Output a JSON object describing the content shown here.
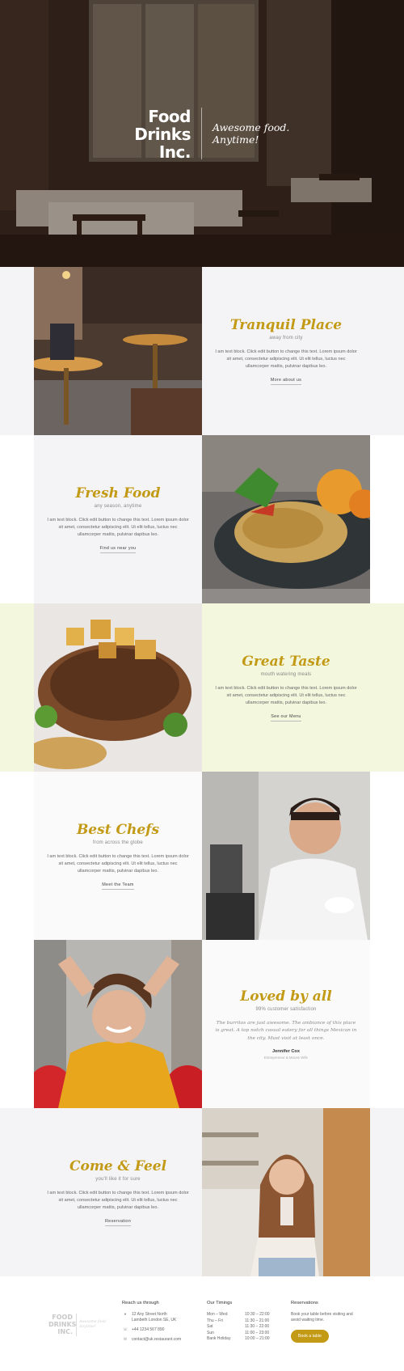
{
  "hero": {
    "brand": [
      "Food",
      "Drinks",
      "Inc."
    ],
    "tagline": [
      "Awesome food.",
      "Anytime!"
    ]
  },
  "sections": [
    {
      "title": "Tranquil Place",
      "subtitle": "away from city",
      "text": "I am text block. Click edit button to change this text. Lorem ipsum dolor sit amet, consectetur adipiscing elit. Ut elit tellus, luctus nec ullamcorper mattis, pulvinar dapibus leo.",
      "link": "More about us",
      "image": "restaurant-interior"
    },
    {
      "title": "Fresh Food",
      "subtitle": "any season, anytime",
      "text": "I am text block. Click edit button to change this text. Lorem ipsum dolor sit amet, consectetur adipiscing elit. Ut elit tellus, luctus nec ullamcorper mattis, pulvinar dapibus leo.",
      "link": "Find us near you",
      "image": "pasta-dish"
    },
    {
      "title": "Great Taste",
      "subtitle": "mouth watering meals",
      "text": "I am text block. Click edit button to change this text. Lorem ipsum dolor sit amet, consectetur adipiscing elit. Ut elit tellus, luctus nec ullamcorper mattis, pulvinar dapibus leo.",
      "link": "See our Menu",
      "image": "grilled-meat"
    },
    {
      "title": "Best Chefs",
      "subtitle": "from across the globe",
      "text": "I am text block. Click edit button to change this text. Lorem ipsum dolor sit amet, consectetur adipiscing elit. Ut elit tellus, luctus nec ullamcorper mattis, pulvinar dapibus leo.",
      "link": "Meet the Team",
      "image": "chef-portrait"
    },
    {
      "title": "Loved by all",
      "subtitle": "99% customer satisfaction",
      "quote": "The burritos are just awesome. The ambiance of this place is great. A top notch casual eatery for all things Mexican in the city. Must visit at least once.",
      "author": "Jennifer Cox",
      "role": "Entrepreneur & Mouse Wife",
      "image": "happy-woman"
    },
    {
      "title": "Come & Feel",
      "subtitle": "you'll like it for sure",
      "text": "I am text block. Click edit button to change this text. Lorem ipsum dolor sit amet, consectetur adipiscing elit. Ut elit tellus, luctus nec ullamcorper mattis, pulvinar dapibus leo.",
      "link": "Reservation",
      "image": "woman-milkshake"
    }
  ],
  "footer": {
    "logo": [
      "FOOD",
      "DRINKS",
      "INC."
    ],
    "logo_tag": [
      "Awesome food.",
      "Anytime!"
    ],
    "reach": {
      "heading": "Reach us through",
      "address": [
        "12 Any Street North",
        "Lambeth London SE, UK"
      ],
      "phone": "+44 1234 567 890",
      "email": "contact@uk.restaurant.com"
    },
    "timings": {
      "heading": "Our Timings",
      "rows": [
        [
          "Mon – Wed",
          "10:30 – 22:00"
        ],
        [
          "Thu – Fri",
          "11:30 – 21:00"
        ],
        [
          "Sat",
          "11:30 – 22:00"
        ],
        [
          "Sun",
          "11:00 – 23:00"
        ],
        [
          "Bank Holiday",
          "10:00 – 21:00"
        ]
      ]
    },
    "reservations": {
      "heading": "Reservations",
      "text": "Book your table before visiting and avoid waiting time.",
      "button": "Book a table"
    }
  },
  "colors": {
    "accent": "#c39a16",
    "band_grey": "#f4f4f6",
    "band_green": "#f2f7de",
    "band_white": "#ffffff"
  }
}
